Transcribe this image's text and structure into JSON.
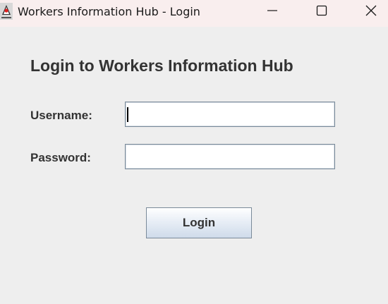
{
  "window": {
    "title": "Workers Information Hub - Login",
    "icon": "java-duke-icon",
    "controls": [
      "minimize-icon",
      "maximize-icon",
      "close-icon"
    ]
  },
  "form": {
    "heading": "Login to Workers Information Hub",
    "username_label": "Username:",
    "username_value": "",
    "password_label": "Password:",
    "password_value": "",
    "submit_label": "Login"
  },
  "colors": {
    "titlebar_bg": "#f9eeee",
    "window_bg": "#eeeeee",
    "text": "#333333",
    "field_border": "#7a8a99",
    "button_gradient_top": "#ffffff",
    "button_gradient_bottom": "#cfdbea"
  }
}
